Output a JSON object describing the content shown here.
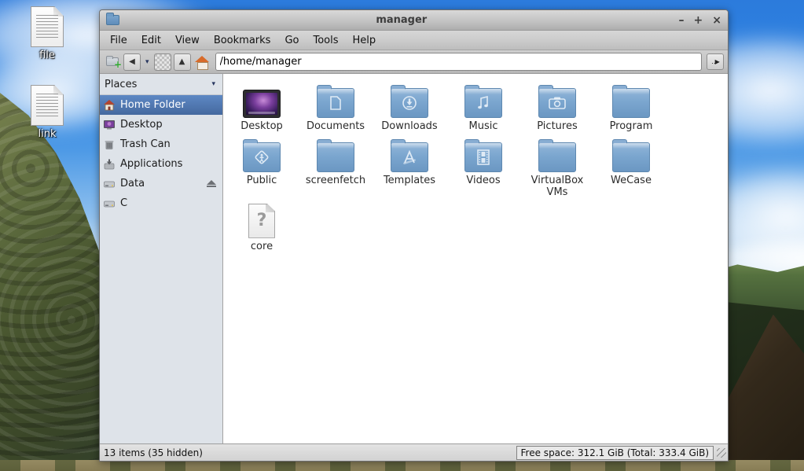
{
  "desktop": {
    "icons": [
      {
        "label": "file"
      },
      {
        "label": "link"
      }
    ]
  },
  "window": {
    "title": "manager",
    "controls": {
      "minimize": "–",
      "maximize": "+",
      "close": "×"
    },
    "menu": [
      "File",
      "Edit",
      "View",
      "Bookmarks",
      "Go",
      "Tools",
      "Help"
    ],
    "toolbar": {
      "path_value": "/home/manager",
      "history_arrow": "▾",
      "back_arrow": "◀",
      "forward_arrow": "▶",
      "up_arrow": "▲",
      "end_button": "‥▶"
    },
    "sidebar": {
      "header": "Places",
      "header_arrow": "▾",
      "items": [
        {
          "label": "Home Folder"
        },
        {
          "label": "Desktop"
        },
        {
          "label": "Trash Can"
        },
        {
          "label": "Applications"
        },
        {
          "label": "Data"
        },
        {
          "label": "C"
        }
      ]
    },
    "files": [
      {
        "label": "Desktop",
        "type": "screen"
      },
      {
        "label": "Documents",
        "type": "folder"
      },
      {
        "label": "Downloads",
        "type": "folder"
      },
      {
        "label": "Music",
        "type": "folder"
      },
      {
        "label": "Pictures",
        "type": "folder"
      },
      {
        "label": "Program",
        "type": "folder"
      },
      {
        "label": "Public",
        "type": "folder"
      },
      {
        "label": "screenfetch",
        "type": "folder"
      },
      {
        "label": "Templates",
        "type": "folder"
      },
      {
        "label": "Videos",
        "type": "folder"
      },
      {
        "label": "VirtualBox VMs",
        "type": "folder"
      },
      {
        "label": "WeCase",
        "type": "folder"
      },
      {
        "label": "core",
        "type": "unknown"
      }
    ],
    "statusbar": {
      "left": "13 items (35 hidden)",
      "right": "Free space: 312.1 GiB (Total: 333.4 GiB)"
    }
  },
  "colors": {
    "selection_blue": "#4d77b2",
    "folder_blue": "#7ba6cf",
    "sidebar_bg": "#dee3e9",
    "chrome_gray": "#c6c6c6",
    "sky_blue": "#2f84e2"
  }
}
